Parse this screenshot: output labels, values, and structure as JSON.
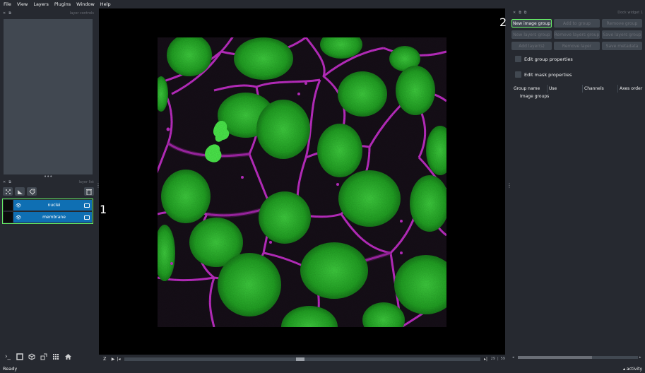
{
  "menubar": {
    "items": [
      "File",
      "View",
      "Layers",
      "Plugins",
      "Window",
      "Help"
    ]
  },
  "left_dock": {
    "layer_controls_title": "layer controls",
    "layer_list_title": "layer list",
    "handle": "•••",
    "layers": [
      {
        "name": "nuclei",
        "selected": true
      },
      {
        "name": "membrane",
        "selected": true
      }
    ]
  },
  "dims": {
    "axis": "Z",
    "current": "29",
    "total": "59"
  },
  "right_dock": {
    "title": "Dock widget 1",
    "buttons": {
      "new_image_group": "New image group",
      "add_to_group": "Add to group",
      "remove_group": "Remove group",
      "new_layers_group": "New layers group",
      "remove_layers_group": "Remove layers group",
      "save_layers_group": "Save layers group",
      "add_layers": "Add layer(s)",
      "remove_layer": "Remove layer",
      "save_metadata": "Save metadata"
    },
    "checkboxes": {
      "edit_group_properties": "Edit group properties",
      "edit_mask_properties": "Edit mask properties"
    },
    "table": {
      "columns": [
        "Group name",
        "Use",
        "Channels",
        "Axes order"
      ],
      "root": "Image groups"
    }
  },
  "status": {
    "text": "Ready",
    "activity": "activity"
  },
  "annotations": {
    "left": "1",
    "right": "2"
  },
  "colors": {
    "accent_green": "#66ee66",
    "layer_selected": "#0f6fb3",
    "panel": "#414851",
    "background": "#262930"
  }
}
